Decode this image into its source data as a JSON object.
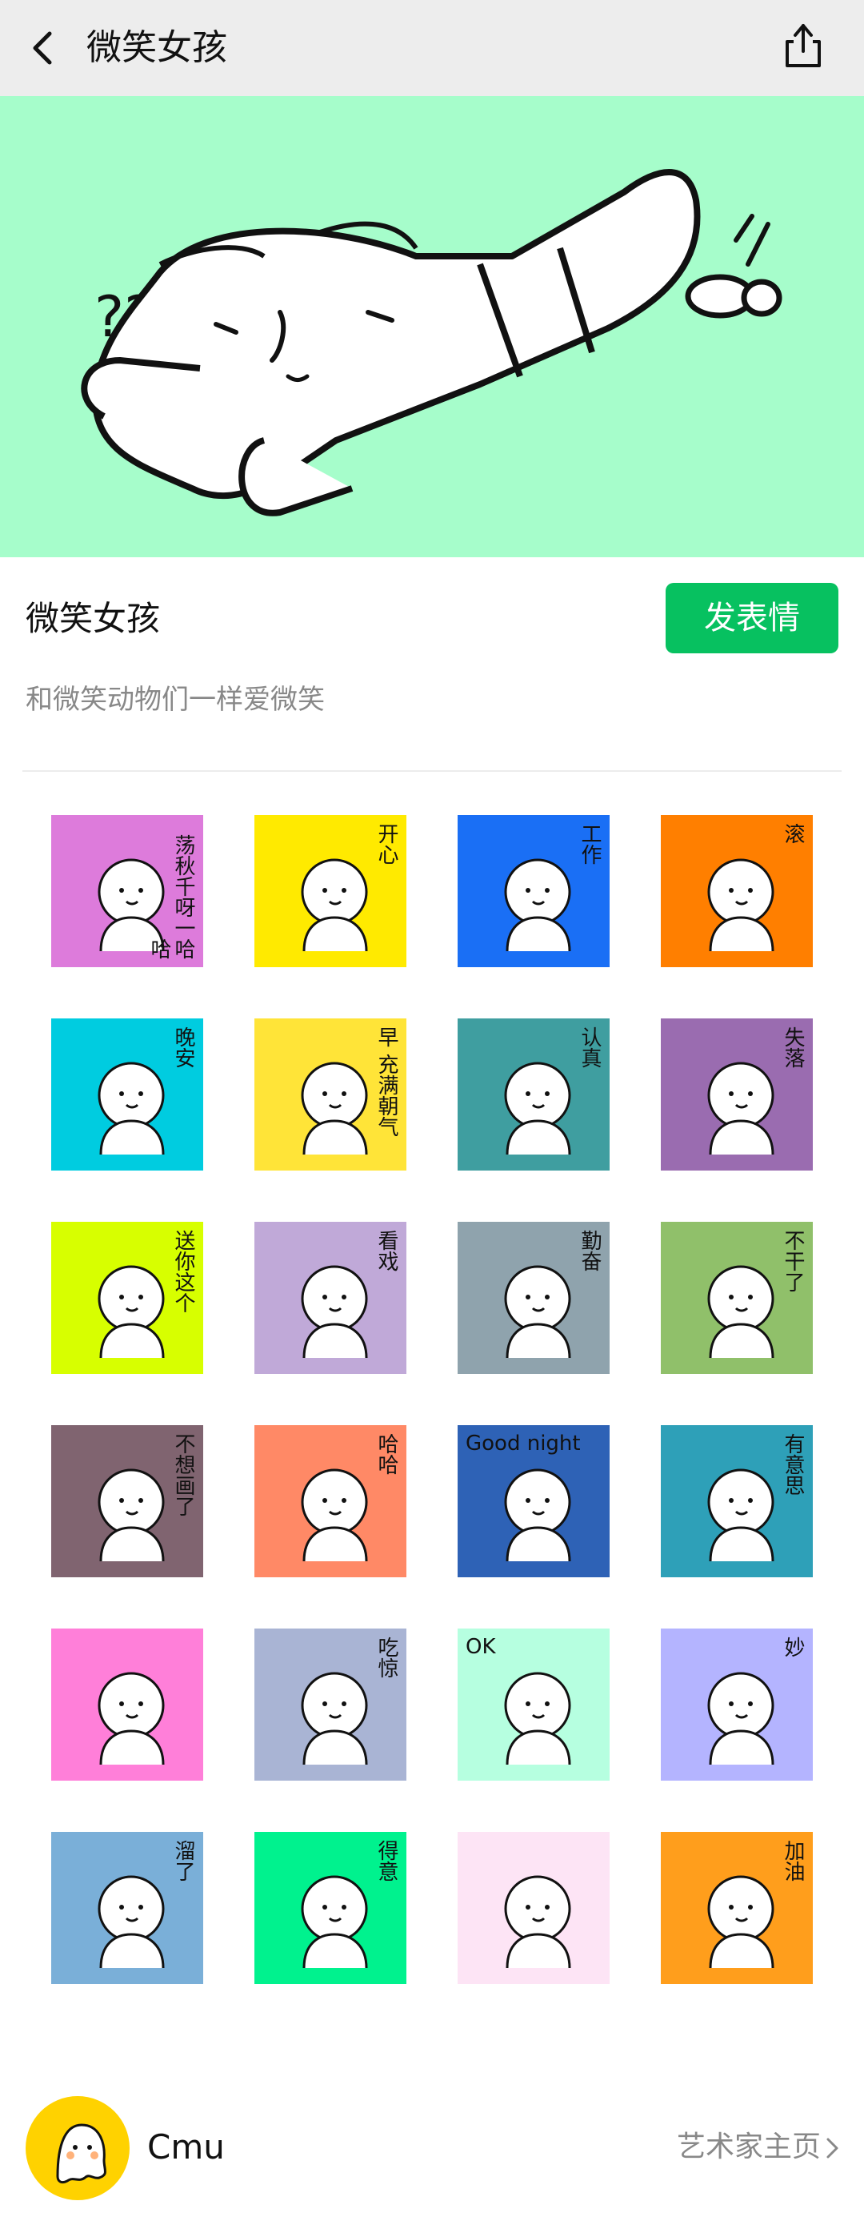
{
  "nav": {
    "title": "微笑女孩",
    "back_icon": "chevron-left-icon",
    "share_icon": "share-icon"
  },
  "banner": {
    "background": "#a6fdcb"
  },
  "pack": {
    "title": "微笑女孩",
    "send_label": "发表情",
    "description": "和微笑动物们一样爱微笑"
  },
  "stickers": [
    {
      "bg": "#dd7bdb",
      "text": "荡秋千呀一哈哈"
    },
    {
      "bg": "#ffea00",
      "text": "开心"
    },
    {
      "bg": "#1a6ff5",
      "text": "工作"
    },
    {
      "bg": "#ff7f00",
      "text": "滚"
    },
    {
      "bg": "#00cce0",
      "text": "晚安"
    },
    {
      "bg": "#ffe438",
      "text": "早 充满朝气"
    },
    {
      "bg": "#3f9ea0",
      "text": "认真"
    },
    {
      "bg": "#9a6cb0",
      "text": "失落"
    },
    {
      "bg": "#d7ff00",
      "text": "送你这个"
    },
    {
      "bg": "#c0a9d8",
      "text": "看戏"
    },
    {
      "bg": "#8fa3ad",
      "text": "勤奋"
    },
    {
      "bg": "#90c06a",
      "text": "不干了"
    },
    {
      "bg": "#806470",
      "text": "不想画了"
    },
    {
      "bg": "#ff8966",
      "text": "哈哈"
    },
    {
      "bg": "#2e62b6",
      "text": "Good night"
    },
    {
      "bg": "#2ea0b8",
      "text": "有意思"
    },
    {
      "bg": "#ff7fd9",
      "text": ""
    },
    {
      "bg": "#a9b4d4",
      "text": "吃惊"
    },
    {
      "bg": "#b6ffe0",
      "text": "OK"
    },
    {
      "bg": "#b4b4ff",
      "text": "妙"
    },
    {
      "bg": "#7aafd8",
      "text": "溜了"
    },
    {
      "bg": "#00f28e",
      "text": "得意"
    },
    {
      "bg": "#fde4f5",
      "text": ""
    },
    {
      "bg": "#ff9e1c",
      "text": "加油"
    }
  ],
  "artist": {
    "name": "Cmu",
    "home_link": "艺术家主页",
    "avatar_bg": "#ffd200"
  }
}
